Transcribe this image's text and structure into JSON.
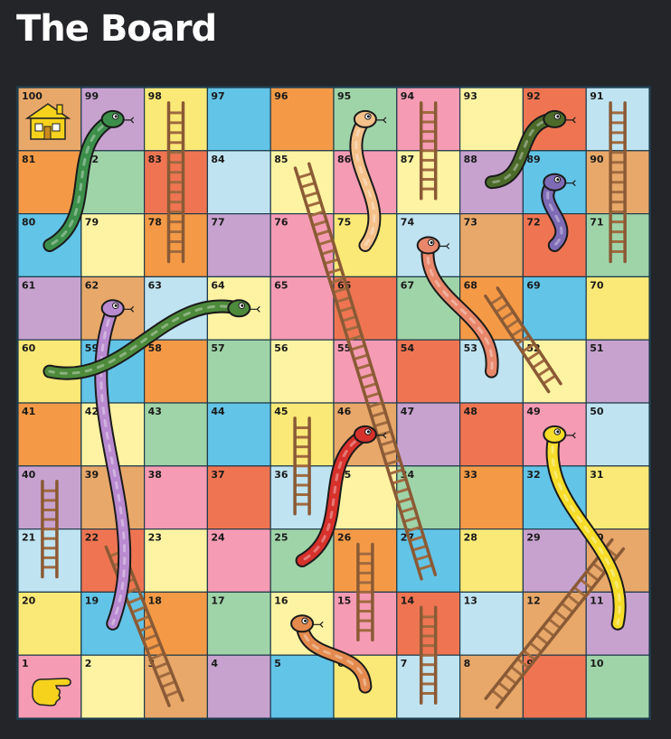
{
  "page": {
    "title": "The Board"
  },
  "board": {
    "rows": 10,
    "cols": 10,
    "home_icon": "house-icon",
    "start_icon": "pointing-hand-icon",
    "cell_colors": [
      [
        "#e8a86a",
        "#c7a2cf",
        "#fbe977",
        "#62c4e7",
        "#f49a47",
        "#9fd4a8",
        "#f59bb4",
        "#fdf3a3",
        "#ef7552",
        "#bfe3f1"
      ],
      [
        "#f49a47",
        "#9fd4a8",
        "#ef7552",
        "#bfe3f1",
        "#fdf3a3",
        "#f59bb4",
        "#fdf3a3",
        "#c7a2cf",
        "#62c4e7",
        "#e8a86a"
      ],
      [
        "#62c4e7",
        "#fdf3a3",
        "#f49a47",
        "#c7a2cf",
        "#f59bb4",
        "#fbe977",
        "#bfe3f1",
        "#e8a86a",
        "#ef7552",
        "#9fd4a8"
      ],
      [
        "#c7a2cf",
        "#e8a86a",
        "#bfe3f1",
        "#fdf3a3",
        "#f59bb4",
        "#ef7552",
        "#9fd4a8",
        "#f49a47",
        "#62c4e7",
        "#fbe977"
      ],
      [
        "#fbe977",
        "#62c4e7",
        "#f49a47",
        "#9fd4a8",
        "#fdf3a3",
        "#f59bb4",
        "#ef7552",
        "#bfe3f1",
        "#fdf3a3",
        "#c7a2cf"
      ],
      [
        "#f49a47",
        "#fdf3a3",
        "#9fd4a8",
        "#62c4e7",
        "#fbe977",
        "#e8a86a",
        "#c7a2cf",
        "#ef7552",
        "#f59bb4",
        "#bfe3f1"
      ],
      [
        "#c7a2cf",
        "#e8a86a",
        "#f59bb4",
        "#ef7552",
        "#bfe3f1",
        "#fdf3a3",
        "#9fd4a8",
        "#f49a47",
        "#62c4e7",
        "#fbe977"
      ],
      [
        "#bfe3f1",
        "#ef7552",
        "#fdf3a3",
        "#f59bb4",
        "#9fd4a8",
        "#f49a47",
        "#62c4e7",
        "#fbe977",
        "#c7a2cf",
        "#e8a86a"
      ],
      [
        "#fbe977",
        "#62c4e7",
        "#f49a47",
        "#9fd4a8",
        "#fdf3a3",
        "#f59bb4",
        "#ef7552",
        "#bfe3f1",
        "#e8a86a",
        "#c7a2cf"
      ],
      [
        "#f59bb4",
        "#fdf3a3",
        "#e8a86a",
        "#c7a2cf",
        "#62c4e7",
        "#fbe977",
        "#bfe3f1",
        "#e8a86a",
        "#ef7552",
        "#9fd4a8"
      ]
    ],
    "numbers": [
      [
        100,
        99,
        98,
        97,
        96,
        95,
        94,
        93,
        92,
        91
      ],
      [
        81,
        82,
        83,
        84,
        85,
        86,
        87,
        88,
        89,
        90
      ],
      [
        80,
        79,
        78,
        77,
        76,
        75,
        74,
        73,
        72,
        71
      ],
      [
        61,
        62,
        63,
        64,
        65,
        66,
        67,
        68,
        69,
        70
      ],
      [
        60,
        59,
        58,
        57,
        56,
        55,
        54,
        53,
        52,
        51
      ],
      [
        41,
        42,
        43,
        44,
        45,
        46,
        47,
        48,
        49,
        50
      ],
      [
        40,
        39,
        38,
        37,
        36,
        35,
        34,
        33,
        32,
        31
      ],
      [
        21,
        22,
        23,
        24,
        25,
        26,
        27,
        28,
        29,
        30
      ],
      [
        20,
        19,
        18,
        17,
        16,
        15,
        14,
        13,
        12,
        11
      ],
      [
        1,
        2,
        3,
        4,
        5,
        6,
        7,
        8,
        9,
        10
      ]
    ],
    "ladders": [
      {
        "from": 3,
        "to": 22
      },
      {
        "from": 21,
        "to": 40
      },
      {
        "from": 7,
        "to": 14
      },
      {
        "from": 15,
        "to": 26
      },
      {
        "from": 8,
        "to": 30
      },
      {
        "from": 36,
        "to": 45
      },
      {
        "from": 27,
        "to": 85
      },
      {
        "from": 52,
        "to": 68
      },
      {
        "from": 78,
        "to": 98
      },
      {
        "from": 87,
        "to": 94
      },
      {
        "from": 71,
        "to": 91
      }
    ],
    "snakes": [
      {
        "head": 99,
        "tail": 80,
        "color": "#3c8f4a"
      },
      {
        "head": 95,
        "tail": 75,
        "color": "#f5c18a"
      },
      {
        "head": 92,
        "tail": 88,
        "color": "#4c6b2a"
      },
      {
        "head": 89,
        "tail": 72,
        "color": "#7e6bb6"
      },
      {
        "head": 74,
        "tail": 53,
        "color": "#e9876b"
      },
      {
        "head": 62,
        "tail": 19,
        "color": "#b98ad0"
      },
      {
        "head": 64,
        "tail": 60,
        "color": "#4d8a3b"
      },
      {
        "head": 46,
        "tail": 25,
        "color": "#d7312c"
      },
      {
        "head": 49,
        "tail": 11,
        "color": "#f6dd2a"
      },
      {
        "head": 16,
        "tail": 6,
        "color": "#e48a4e"
      }
    ]
  }
}
